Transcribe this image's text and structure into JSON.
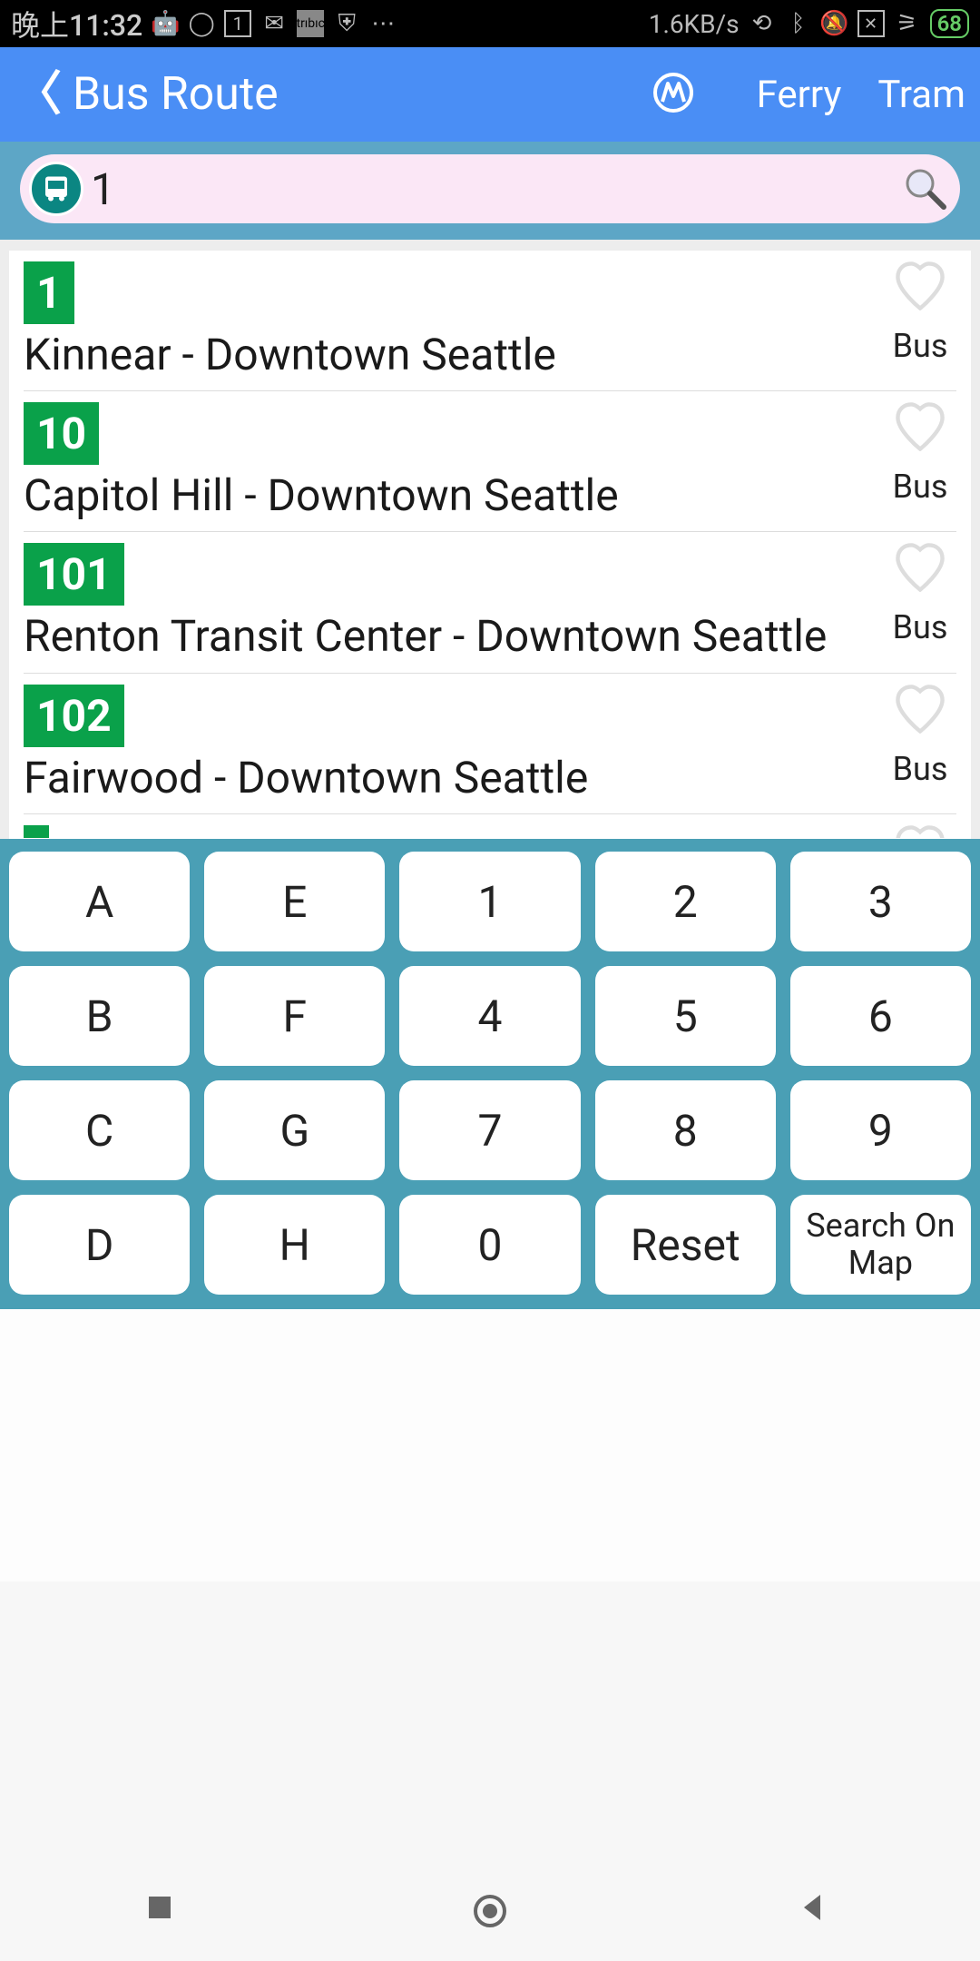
{
  "status": {
    "time": "晚上11:32",
    "net_speed": "1.6KB/s",
    "battery": "68"
  },
  "header": {
    "title": "Bus Route",
    "link1": "Ferry",
    "link2": "Tram"
  },
  "search": {
    "value": "1"
  },
  "routes": [
    {
      "num": "1",
      "desc": "Kinnear - Downtown Seattle",
      "type": "Bus"
    },
    {
      "num": "10",
      "desc": "Capitol Hill - Downtown Seattle",
      "type": "Bus"
    },
    {
      "num": "101",
      "desc": "Renton Transit Center - Downtown Seattle",
      "type": "Bus"
    },
    {
      "num": "102",
      "desc": "Fairwood - Downtown Seattle",
      "type": "Bus"
    }
  ],
  "keypad": {
    "rows": [
      [
        "A",
        "E",
        "1",
        "2",
        "3"
      ],
      [
        "B",
        "F",
        "4",
        "5",
        "6"
      ],
      [
        "C",
        "G",
        "7",
        "8",
        "9"
      ],
      [
        "D",
        "H",
        "0",
        "Reset",
        "Search On Map"
      ]
    ]
  }
}
